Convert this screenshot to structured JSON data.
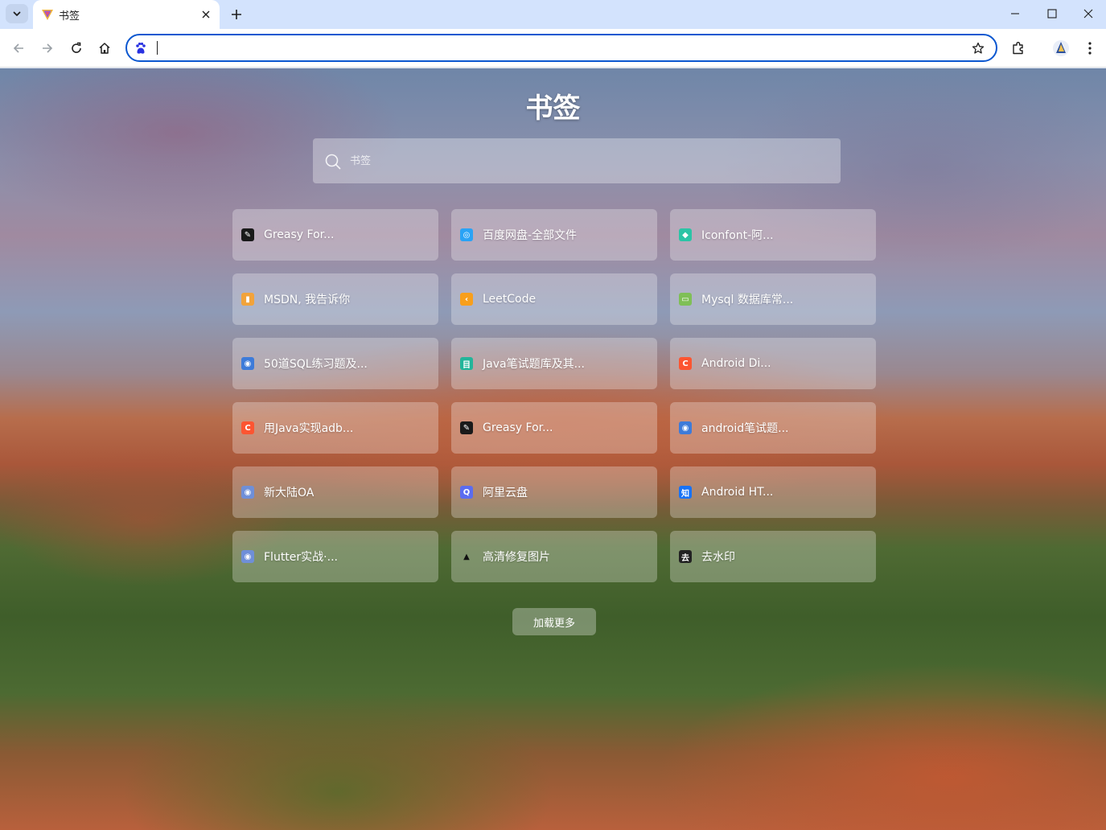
{
  "browser": {
    "tab": {
      "title": "书签",
      "favicon": "vivaldi-style-icon"
    },
    "omnibox": {
      "value": "",
      "placeholder": "",
      "site_icon": "baidu-paw-icon"
    }
  },
  "page": {
    "title": "书签",
    "search": {
      "placeholder": "书签"
    },
    "bookmarks": [
      {
        "label": "Greasy For...",
        "icon": "greasy-fork-icon",
        "color": "#1a1a1a"
      },
      {
        "label": "百度网盘-全部文件",
        "icon": "baidu-netdisk-icon",
        "color": "#2aa3f5"
      },
      {
        "label": "Iconfont-阿...",
        "icon": "iconfont-icon",
        "color": "#2bc4a6"
      },
      {
        "label": "MSDN, 我告诉你",
        "icon": "msdn-icon",
        "color": "#f2a33a"
      },
      {
        "label": "LeetCode",
        "icon": "leetcode-icon",
        "color": "#f89f1b"
      },
      {
        "label": "Mysql 数据库常...",
        "icon": "mysql-icon",
        "color": "#7fbf56"
      },
      {
        "label": "50道SQL练习题及...",
        "icon": "globe-icon",
        "color": "#3d7bd9"
      },
      {
        "label": "Java笔试题库及其...",
        "icon": "java-quiz-icon",
        "color": "#22b59a"
      },
      {
        "label": "Android Di...",
        "icon": "csdn-icon",
        "color": "#fc5531"
      },
      {
        "label": "用Java实现adb...",
        "icon": "csdn-icon",
        "color": "#fc5531"
      },
      {
        "label": "Greasy For...",
        "icon": "greasy-fork-icon",
        "color": "#1a1a1a"
      },
      {
        "label": "android笔试题...",
        "icon": "globe-icon",
        "color": "#3d7bd9"
      },
      {
        "label": "新大陆OA",
        "icon": "globe-icon",
        "color": "#6f8fd8"
      },
      {
        "label": "阿里云盘",
        "icon": "aliyun-drive-icon",
        "color": "#5b6cf0"
      },
      {
        "label": "Android HT...",
        "icon": "zhihu-icon",
        "color": "#1772f6"
      },
      {
        "label": "Flutter实战·...",
        "icon": "globe-icon",
        "color": "#6f8fd8"
      },
      {
        "label": "高清修复图片",
        "icon": "triangle-icon",
        "color": "#111111"
      },
      {
        "label": "去水印",
        "icon": "watermark-icon",
        "color": "#222222"
      }
    ],
    "load_more_label": "加载更多"
  }
}
